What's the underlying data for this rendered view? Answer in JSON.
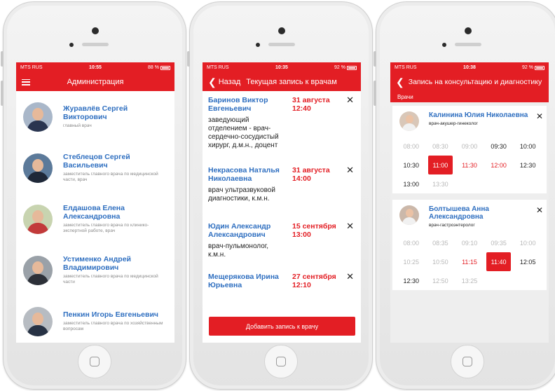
{
  "colors": {
    "accent": "#e31e24",
    "link": "#2f6fc0"
  },
  "phone1": {
    "status": {
      "carrier": "MTS RUS",
      "time": "10:55",
      "battery": "88 %"
    },
    "title": "Администрация",
    "items": [
      {
        "name": "Журавлёв Сергей Викторович",
        "role": "главный врач",
        "avatar_bg": "#a9b7c9",
        "avatar_body": "#2a3550"
      },
      {
        "name": "Стеблецов Сергей Васильевич",
        "role": "заместитель главного врача по медицинской части, врач",
        "avatar_bg": "#5c7a9a",
        "avatar_body": "#1f2838"
      },
      {
        "name": "Елдашова Елена Александровна",
        "role": "заместитель главного врача по клинико-экспертной работе, врач",
        "avatar_bg": "#c8d4b0",
        "avatar_body": "#c23a3a"
      },
      {
        "name": "Устименко Андрей Владимирович",
        "role": "заместитель главного врача по медицинской части",
        "avatar_bg": "#9aa1a8",
        "avatar_body": "#2c3038"
      },
      {
        "name": "Пенкин Игорь Евгеньевич",
        "role": "заместитель главного врача по хозяйственным вопросам",
        "avatar_bg": "#b7bcc2",
        "avatar_body": "#273244"
      }
    ]
  },
  "phone2": {
    "status": {
      "carrier": "MTS RUS",
      "time": "10:35",
      "battery": "92 %"
    },
    "back_label": "Назад",
    "title": "Текущая запись к врачам",
    "appointments": [
      {
        "name": "Баринов Виктор Евгеньевич",
        "date": "31 августа 12:40",
        "desc": "заведующий отделением - врач-сердечно-сосудистый хирург, д.м.н., доцент"
      },
      {
        "name": "Некрасова Наталья Николаевна",
        "date": "31 августа 14:00",
        "desc": "врач ультразвуковой диагностики, к.м.н."
      },
      {
        "name": "Юдин Александр Александрович",
        "date": "15 сентября 13:00",
        "desc": "врач-пульмонолог, к.м.н."
      },
      {
        "name": "Мещерякова Ирина Юрьевна",
        "date": "27 сентября 12:10",
        "desc": ""
      }
    ],
    "add_button": "Добавить запись к врачу"
  },
  "phone3": {
    "status": {
      "carrier": "MTS RUS",
      "time": "10:38",
      "battery": "92 %"
    },
    "title": "Запись на консультацию и диагностику",
    "subtitle": "Врачи",
    "doctors": [
      {
        "name": "Калинина Юлия Николаевна",
        "spec": "врач-акушер-гинеколог",
        "avatar_bg": "#d9c7b8",
        "slots": [
          {
            "t": "08:00",
            "s": "past"
          },
          {
            "t": "08:30",
            "s": "past"
          },
          {
            "t": "09:00",
            "s": "past"
          },
          {
            "t": "09:30",
            "s": "free"
          },
          {
            "t": "10:00",
            "s": "free"
          },
          {
            "t": "10:30",
            "s": "free"
          },
          {
            "t": "11:00",
            "s": "selected"
          },
          {
            "t": "11:30",
            "s": "busy"
          },
          {
            "t": "12:00",
            "s": "busy"
          },
          {
            "t": "12:30",
            "s": "free"
          },
          {
            "t": "13:00",
            "s": "free"
          },
          {
            "t": "13:30",
            "s": "past"
          }
        ]
      },
      {
        "name": "Болтышева Анна Александровна",
        "spec": "врач-гастроэнтеролог",
        "avatar_bg": "#cbb8aa",
        "slots": [
          {
            "t": "08:00",
            "s": "past"
          },
          {
            "t": "08:35",
            "s": "past"
          },
          {
            "t": "09:10",
            "s": "past"
          },
          {
            "t": "09:35",
            "s": "past"
          },
          {
            "t": "10:00",
            "s": "past"
          },
          {
            "t": "10:25",
            "s": "past"
          },
          {
            "t": "10:50",
            "s": "past"
          },
          {
            "t": "11:15",
            "s": "busy"
          },
          {
            "t": "11:40",
            "s": "selected"
          },
          {
            "t": "12:05",
            "s": "free"
          },
          {
            "t": "12:30",
            "s": "free"
          },
          {
            "t": "12:50",
            "s": "past"
          },
          {
            "t": "13:25",
            "s": "past"
          }
        ]
      }
    ]
  }
}
